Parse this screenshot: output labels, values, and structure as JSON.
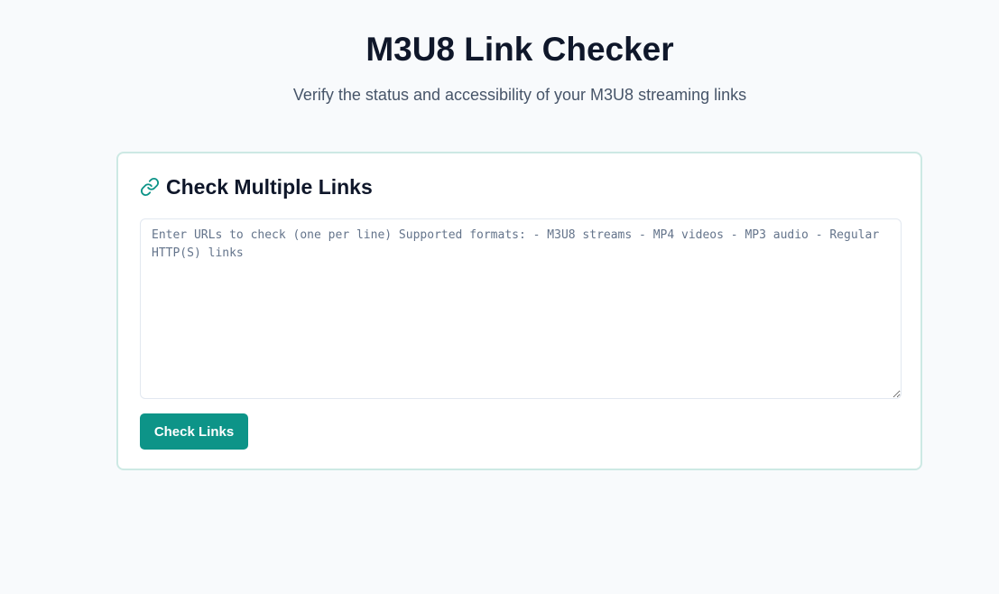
{
  "header": {
    "title": "M3U8 Link Checker",
    "subtitle": "Verify the status and accessibility of your M3U8 streaming links"
  },
  "checker": {
    "icon": "link-icon",
    "title": "Check Multiple Links",
    "textarea": {
      "value": "",
      "placeholder": "Enter URLs to check (one per line) Supported formats: - M3U8 streams - MP4 videos - MP3 audio - Regular HTTP(S) links"
    },
    "button_label": "Check Links"
  },
  "colors": {
    "accent": "#0d9488",
    "card_border": "#cde9e4",
    "background": "#f8fafc",
    "title_text": "#0f172a",
    "subtitle_text": "#475569"
  }
}
